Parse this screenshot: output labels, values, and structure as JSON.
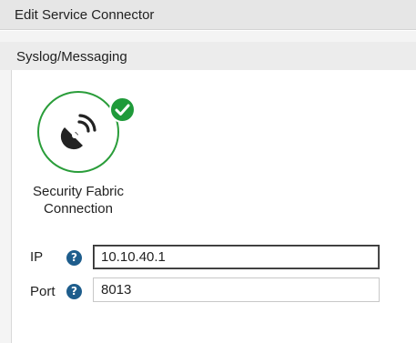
{
  "dialog": {
    "title": "Edit Service Connector"
  },
  "section": {
    "title": "Syslog/Messaging"
  },
  "connector": {
    "label": "Security Fabric Connection",
    "icon": "satellite-dish-icon",
    "status": "connected",
    "status_color": "#1f9a3a"
  },
  "fields": {
    "ip": {
      "label": "IP",
      "value": "10.10.40.1"
    },
    "port": {
      "label": "Port",
      "value": "8013"
    }
  },
  "help_glyph": "?",
  "colors": {
    "help_icon": "#1e5d8c",
    "status_ring": "#2a9d3a"
  }
}
